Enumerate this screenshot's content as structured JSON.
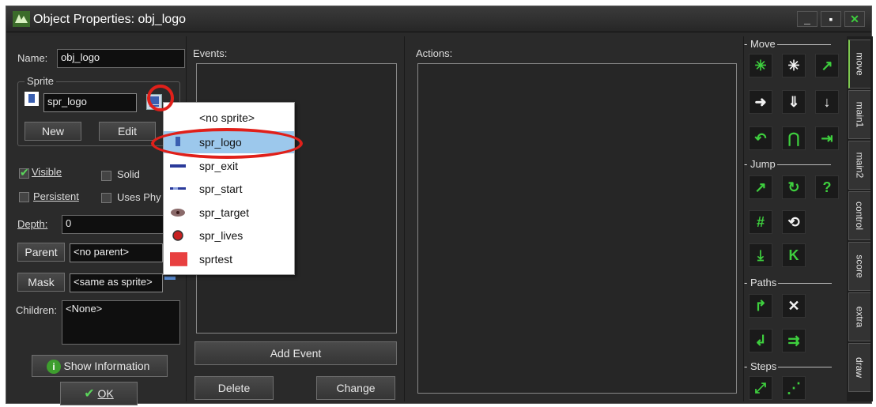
{
  "window": {
    "title": "Object Properties: obj_logo"
  },
  "props": {
    "name_label": "Name:",
    "name_value": "obj_logo",
    "sprite_group": "Sprite",
    "sprite_value": "spr_logo",
    "new_label": "New",
    "edit_label": "Edit",
    "visible_label": "Visible",
    "solid_label": "Solid",
    "persistent_label": "Persistent",
    "uses_physics_label": "Uses Phy",
    "depth_label": "Depth:",
    "depth_value": "0",
    "parent_label": "Parent",
    "parent_value": "<no parent>",
    "mask_label": "Mask",
    "mask_value": "<same as sprite>",
    "children_label": "Children:",
    "children_value": "<None>",
    "show_info_label": "Show Information",
    "ok_label": "OK",
    "visible_checked": true,
    "solid_checked": false,
    "persistent_checked": false,
    "uses_physics_checked": false
  },
  "events": {
    "label": "Events:",
    "add_label": "Add Event",
    "delete_label": "Delete",
    "change_label": "Change"
  },
  "actions": {
    "label": "Actions:"
  },
  "library": {
    "move_label": "Move",
    "jump_label": "Jump",
    "paths_label": "Paths",
    "steps_label": "Steps"
  },
  "tabs": [
    "move",
    "main1",
    "main2",
    "control",
    "score",
    "extra",
    "draw"
  ],
  "sprite_menu": {
    "items": [
      {
        "label": "<no sprite>",
        "icon": "none"
      },
      {
        "label": "spr_logo",
        "icon": "logo-sprite-icon",
        "selected": true
      },
      {
        "label": "spr_exit",
        "icon": "exit-sprite-icon"
      },
      {
        "label": "spr_start",
        "icon": "start-sprite-icon"
      },
      {
        "label": "spr_target",
        "icon": "target-sprite-icon"
      },
      {
        "label": "spr_lives",
        "icon": "lives-sprite-icon"
      },
      {
        "label": "sprtest",
        "icon": "test-sprite-icon"
      }
    ]
  },
  "colors": {
    "highlight_ring": "#e0201a",
    "accent_green": "#3ecf3e",
    "selected_item": "#9cc8ec"
  }
}
